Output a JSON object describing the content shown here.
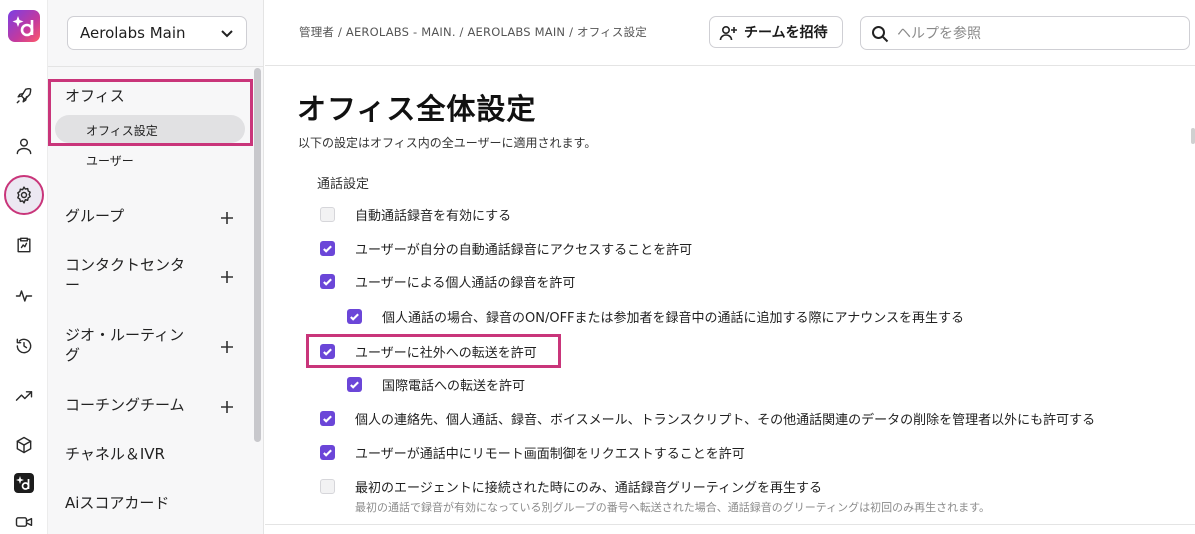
{
  "workspace": {
    "name": "Aerolabs Main"
  },
  "rail": {
    "icons": [
      "rocket-icon",
      "person-icon",
      "gear-icon",
      "clipboard-icon",
      "activity-icon",
      "history-icon",
      "trending-icon",
      "cube-icon",
      "brand-icon",
      "video-icon"
    ]
  },
  "sidebar": {
    "office": {
      "label": "オフィス",
      "items": [
        "オフィス設定",
        "ユーザー"
      ]
    },
    "groups": [
      {
        "label": "グループ"
      },
      {
        "label": "コンタクトセンタ\nー"
      },
      {
        "label": "ジオ・ルーティン\nグ"
      },
      {
        "label": "コーチングチーム"
      },
      {
        "label": "チャネル＆IVR"
      },
      {
        "label": "Aiスコアカード"
      }
    ]
  },
  "topbar": {
    "breadcrumb": "管理者 / AEROLABS - MAIN. / AEROLABS MAIN / オフィス設定",
    "invite_label": "チームを招待",
    "search_placeholder": "ヘルプを参照"
  },
  "main": {
    "title": "オフィス全体設定",
    "description": "以下の設定はオフィス内の全ユーザーに適用されます。",
    "section_label": "通話設定",
    "options": [
      {
        "label": "自動通話録音を有効にする",
        "checked": false
      },
      {
        "label": "ユーザーが自分の自動通話録音にアクセスすることを許可",
        "checked": true
      },
      {
        "label": "ユーザーによる個人通話の録音を許可",
        "checked": true
      },
      {
        "label": "個人通話の場合、録音のON/OFFまたは参加者を録音中の通話に追加する際にアナウンスを再生する",
        "checked": true
      },
      {
        "label": "ユーザーに社外への転送を許可",
        "checked": true
      },
      {
        "label": "国際電話への転送を許可",
        "checked": true
      },
      {
        "label": "個人の連絡先、個人通話、録音、ボイスメール、トランスクリプト、その他通話関連のデータの削除を管理者以外にも許可する",
        "checked": true
      },
      {
        "label": "ユーザーが通話中にリモート画面制御をリクエストすることを許可",
        "checked": true
      },
      {
        "label": "最初のエージェントに接続された時にのみ、通話録音グリーティングを再生する",
        "checked": false
      }
    ],
    "last_option_help": "最初の通話で録音が有効になっている別グループの番号へ転送された場合、通話録音のグリーティングは初回のみ再生されます。"
  },
  "colors": {
    "accent": "#6b46d8",
    "highlight": "#c9357a"
  }
}
